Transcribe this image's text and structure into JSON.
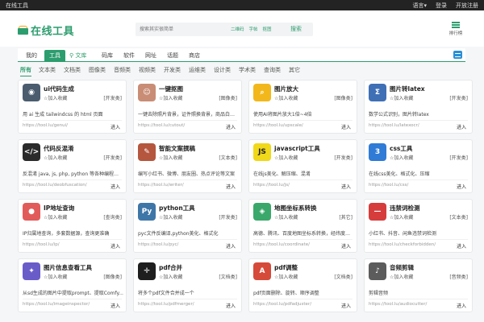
{
  "topbar": {
    "brand": "在线工具",
    "language": "语言▾",
    "login": "登录",
    "register": "开放注册"
  },
  "header": {
    "logo_text": "在线工具",
    "rank_label": "排行榜"
  },
  "search": {
    "placeholder": "搜索其实很简单",
    "tags": [
      "二维码",
      "字帖",
      "抠图"
    ],
    "button": "搜索"
  },
  "nav": {
    "items": [
      "我的",
      "工具",
      "文库",
      "码库",
      "软件",
      "网址",
      "话题",
      "商店"
    ],
    "active_index": 1
  },
  "subnav": {
    "items": [
      "所有",
      "文本类",
      "文档类",
      "图像类",
      "音频类",
      "视频类",
      "开发类",
      "运维类",
      "设计类",
      "学术类",
      "查询类",
      "其它"
    ],
    "active_index": 0
  },
  "card_common": {
    "fav_label": "加入收藏",
    "go_label": "进入"
  },
  "cards": [
    {
      "title": "ui代码生成",
      "category": "[开发类]",
      "desc": "用 ai 生成 tailwindcss 的 html 页面",
      "url": "https://tool.lu/genui/",
      "icon": "robot-icon",
      "color": "#4b5c6e"
    },
    {
      "title": "一键抠图",
      "category": "[图像类]",
      "desc": "一键去除照片背景，证件照换背景，商品白底图",
      "url": "https://tool.lu/cutout/",
      "icon": "portrait-icon",
      "color": "#c98d76"
    },
    {
      "title": "图片放大",
      "category": "[图像类]",
      "desc": "使用AI将图片放大1倍~4倍",
      "url": "https://tool.lu/upscale/",
      "icon": "magnifier-icon",
      "color": "#f2b81b"
    },
    {
      "title": "图片转latex",
      "category": "[开发类]",
      "desc": "数学公式识别，图片转latex",
      "url": "https://tool.lu/latexocr/",
      "icon": "formula-icon",
      "color": "#3f6fb5"
    },
    {
      "title": "代码反混淆",
      "category": "[开发类]",
      "desc": "反混淆 java, js, php, python 等各种编程语言",
      "url": "https://tool.lu/deobfuscation/",
      "icon": "code-icon",
      "color": "#2b2b2b"
    },
    {
      "title": "智能文案撰稿",
      "category": "[文本类]",
      "desc": "编写小红书、微博、朋友圈、热点评论等文案",
      "url": "https://tool.lu/writer/",
      "icon": "pen-icon",
      "color": "#b5563e"
    },
    {
      "title": "javascript工具",
      "category": "[开发类]",
      "desc": "在线js美化、解压缩、混淆",
      "url": "https://tool.lu/js/",
      "icon": "js-icon",
      "color": "#f0d81a"
    },
    {
      "title": "css工具",
      "category": "[开发类]",
      "desc": "在线css美化、格式化、压缩",
      "url": "https://tool.lu/css/",
      "icon": "css-icon",
      "color": "#2f7bd6"
    },
    {
      "title": "IP地址查询",
      "category": "[查询类]",
      "desc": "IP归属地查询，多套数据源，查询更准确",
      "url": "https://tool.lu/ip/",
      "icon": "location-icon",
      "color": "#e25b5b"
    },
    {
      "title": "python工具",
      "category": "[开发类]",
      "desc": "pyc文件反编译,python美化、格式化",
      "url": "https://tool.lu/pyc/",
      "icon": "python-icon",
      "color": "#3f76a8"
    },
    {
      "title": "地图坐标系转换",
      "category": "[其它]",
      "desc": "高德、腾讯、百度地图坐标系转换，经纬度转换",
      "url": "https://tool.lu/coordinate/",
      "icon": "map-icon",
      "color": "#3aa86b"
    },
    {
      "title": "违禁词检测",
      "category": "[文本类]",
      "desc": "小红书、抖音、闲鱼违禁词检测",
      "url": "https://tool.lu/checkforbidden/",
      "icon": "forbidden-icon",
      "color": "#d63c3c"
    },
    {
      "title": "图片信息查看工具",
      "category": "[图像类]",
      "desc": "从sd生成的图片中提取prompt、提取Comfy...",
      "url": "https://tool.lu/imageinspector/",
      "icon": "image-info-icon",
      "color": "#6a5cc8"
    },
    {
      "title": "pdf合并",
      "category": "[文档类]",
      "desc": "将多个pdf文件合并成一个",
      "url": "https://tool.lu/pdfmerger/",
      "icon": "merge-icon",
      "color": "#1e1e1e"
    },
    {
      "title": "pdf调整",
      "category": "[文档类]",
      "desc": "pdf页面删除、旋转、顺序调整",
      "url": "https://tool.lu/pdfadjuster/",
      "icon": "pdf-icon",
      "color": "#d64a3a"
    },
    {
      "title": "音频剪辑",
      "category": "[音频类]",
      "desc": "剪辑音频",
      "url": "https://tool.lu/audiocutter/",
      "icon": "audio-icon",
      "color": "#5c5c5c"
    }
  ]
}
